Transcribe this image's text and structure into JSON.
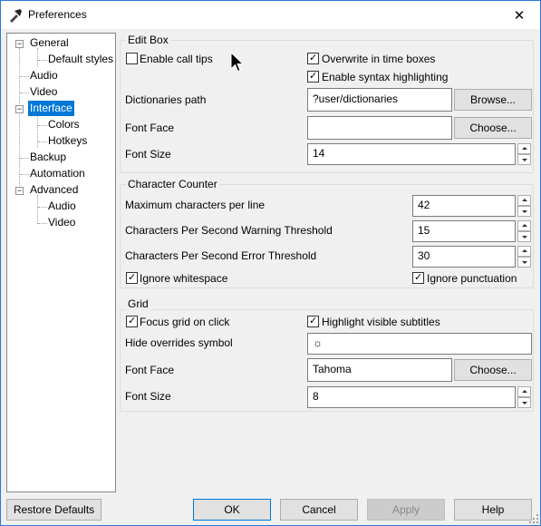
{
  "window": {
    "title": "Preferences",
    "close_glyph": "✕"
  },
  "tree": {
    "items": [
      {
        "label": "General",
        "expander": "−"
      },
      {
        "label": "Default styles"
      },
      {
        "label": "Audio"
      },
      {
        "label": "Video"
      },
      {
        "label": "Interface",
        "expander": "−",
        "selected": true
      },
      {
        "label": "Colors"
      },
      {
        "label": "Hotkeys"
      },
      {
        "label": "Backup"
      },
      {
        "label": "Automation"
      },
      {
        "label": "Advanced",
        "expander": "−"
      },
      {
        "label": "Audio"
      },
      {
        "label": "Video"
      }
    ]
  },
  "edit_box": {
    "title": "Edit Box",
    "enable_call_tips": {
      "label": "Enable call tips",
      "checked": false
    },
    "overwrite_in_time_boxes": {
      "label": "Overwrite in time boxes",
      "checked": true
    },
    "enable_syntax_highlighting": {
      "label": "Enable syntax highlighting",
      "checked": true
    },
    "dictionaries_path": {
      "label": "Dictionaries path",
      "value": "?user/dictionaries",
      "button": "Browse..."
    },
    "font_face": {
      "label": "Font Face",
      "value": "",
      "button": "Choose..."
    },
    "font_size": {
      "label": "Font Size",
      "value": "14"
    }
  },
  "character_counter": {
    "title": "Character Counter",
    "max_chars_per_line": {
      "label": "Maximum characters per line",
      "value": "42"
    },
    "cps_warning": {
      "label": "Characters Per Second Warning Threshold",
      "value": "15"
    },
    "cps_error": {
      "label": "Characters Per Second Error Threshold",
      "value": "30"
    },
    "ignore_whitespace": {
      "label": "Ignore whitespace",
      "checked": true
    },
    "ignore_punctuation": {
      "label": "Ignore punctuation",
      "checked": true
    }
  },
  "grid": {
    "title": "Grid",
    "focus_grid_on_click": {
      "label": "Focus grid on click",
      "checked": true
    },
    "highlight_visible_subtitles": {
      "label": "Highlight visible subtitles",
      "checked": true
    },
    "hide_overrides_symbol": {
      "label": "Hide overrides symbol",
      "value": "☼"
    },
    "font_face": {
      "label": "Font Face",
      "value": "Tahoma",
      "button": "Choose..."
    },
    "font_size": {
      "label": "Font Size",
      "value": "8"
    }
  },
  "footer": {
    "restore_defaults": "Restore Defaults",
    "ok": "OK",
    "cancel": "Cancel",
    "apply": "Apply",
    "help": "Help"
  },
  "check_glyph": "✓"
}
